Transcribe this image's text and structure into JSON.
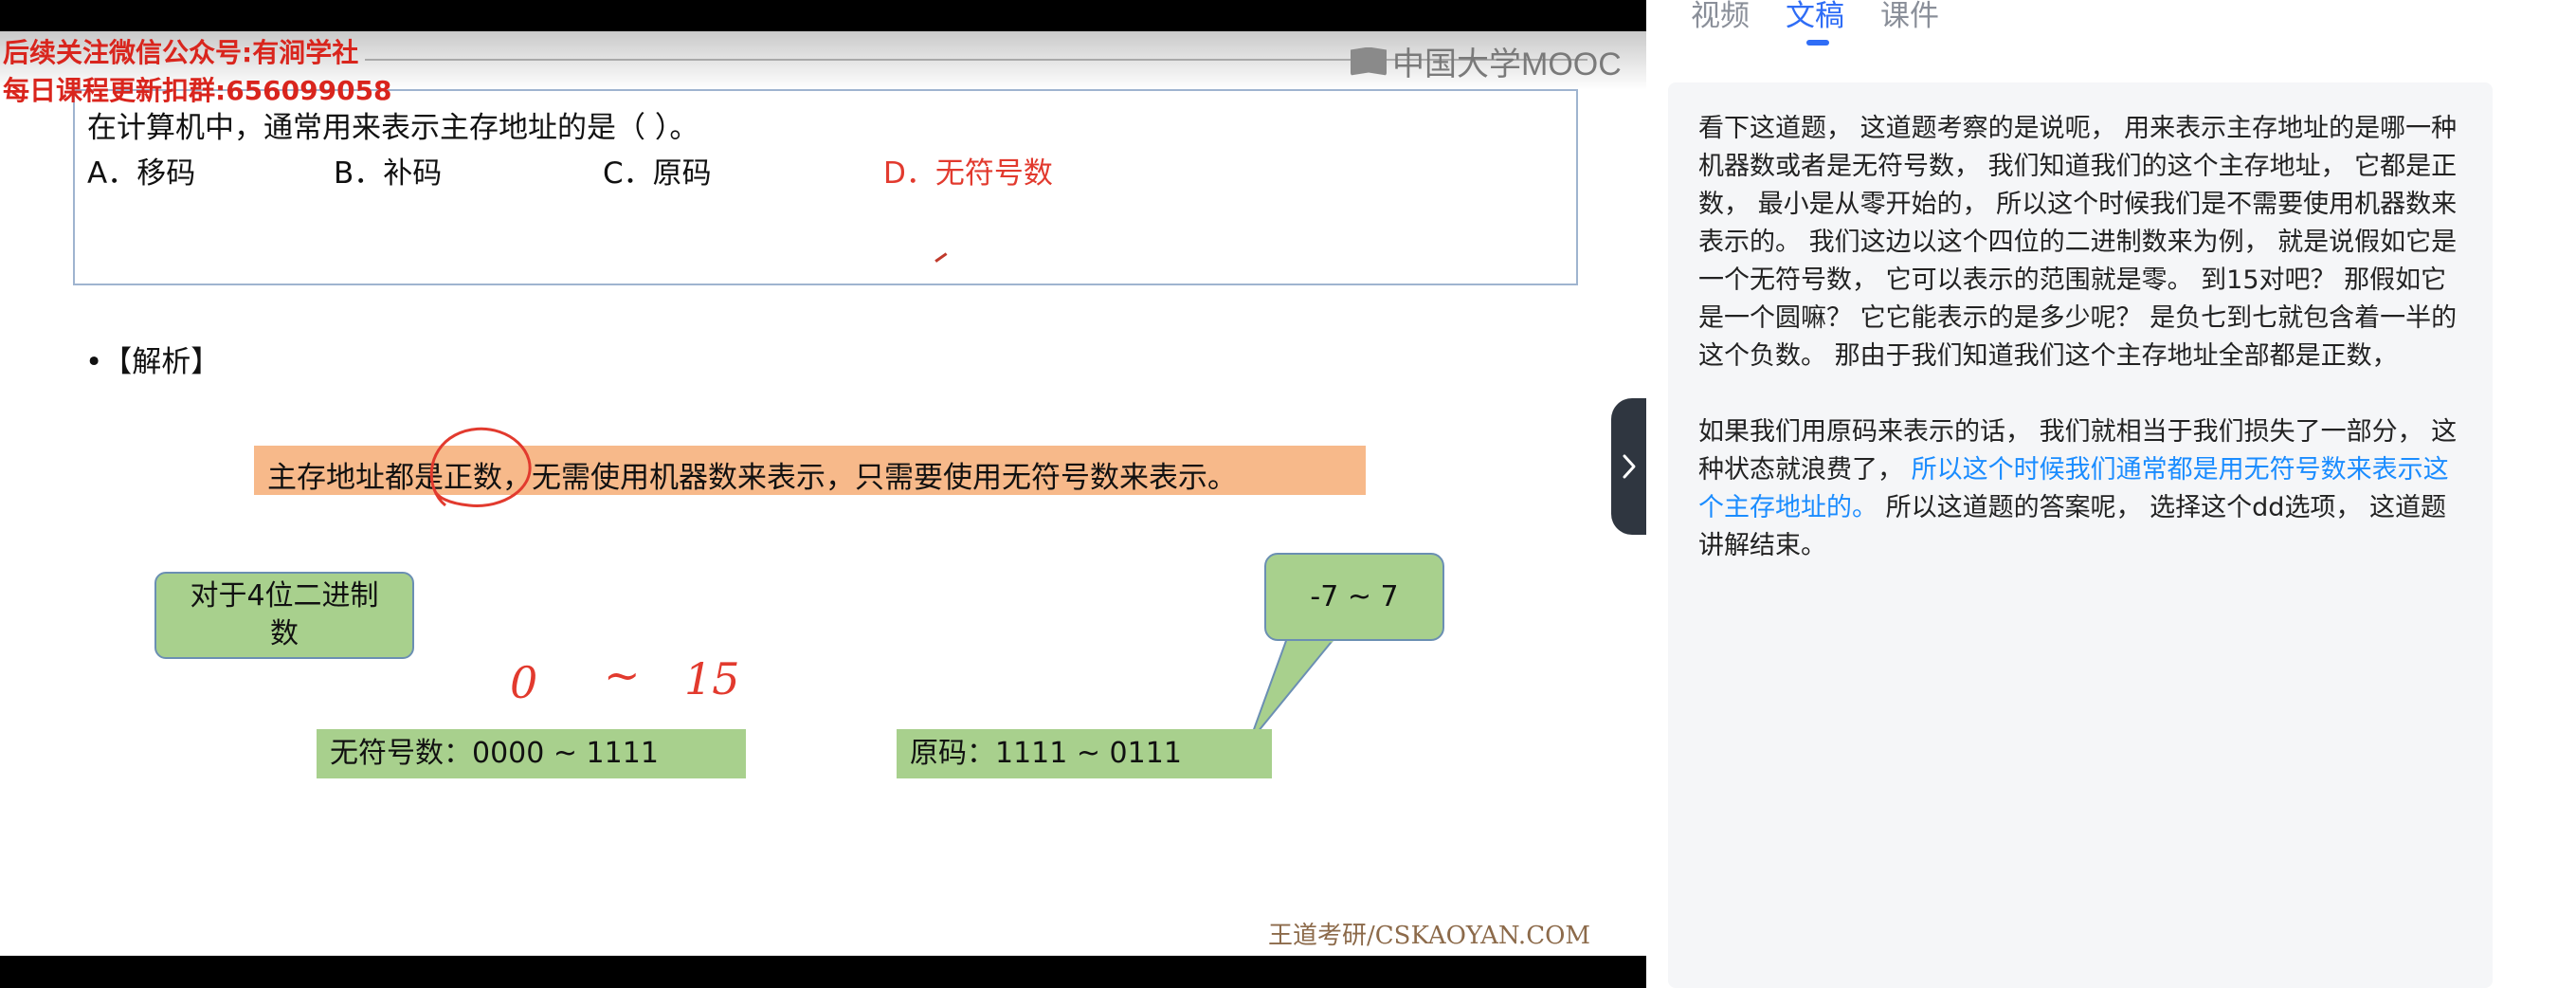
{
  "video": {
    "watermark_line1": "后续关注微信公众号:有涧学社",
    "watermark_line2": "每日课程更新扣群:656099058",
    "logo_text": "中国大学MOOC",
    "question": "在计算机中，通常用来表示主存地址的是（    ）。",
    "options": [
      "A．移码",
      "B．补码",
      "C．原码",
      "D．无符号数"
    ],
    "analysis_label": "•【解析】",
    "orange_text": "主存地址都是正数，无需使用机器数来表示，只需要使用无符号数来表示。",
    "callout_line1": "对于4位二进制",
    "callout_line2": "数",
    "range_signed": "-7  ~  7",
    "hand_range": [
      "0",
      "~",
      "15"
    ],
    "unsigned_range": "无符号数：0000    ~     1111",
    "sign_magnitude_range": "原码：1111     ~     0111",
    "footer_credit": "王道考研/CSKAOYAN.COM"
  },
  "panel": {
    "tabs": [
      "视频",
      "文稿",
      "课件"
    ],
    "active_tab": "文稿",
    "paragraph1": "看下这道题， 这道题考察的是说呃， 用来表示主存地址的是哪一种机器数或者是无符号数， 我们知道我们的这个主存地址， 它都是正数， 最小是从零开始的， 所以这个时候我们是不需要使用机器数来表示的。 我们这边以这个四位的二进制数来为例， 就是说假如它是一个无符号数， 它可以表示的范围就是零。 到15对吧？ 那假如它是一个圆嘛？ 它它能表示的是多少呢？ 是负七到七就包含着一半的这个负数。 那由于我们知道我们这个主存地址全部都是正数，",
    "paragraph2_a": "如果我们用原码来表示的话， 我们就相当于我们损失了一部分， 这种状态就浪费了， ",
    "paragraph2_highlight": "所以这个时候我们通常都是用无符号数来表示这个主存地址的。",
    "paragraph2_b": " 所以这道题的答案呢， 选择这个dd选项， 这道题讲解结束。"
  },
  "colors": {
    "accent_blue": "#2f6df6",
    "highlight_blue": "#1a8cff",
    "answer_red": "#e23a2e",
    "orange_bar": "#f7b98a",
    "green_box": "#a8d08d"
  }
}
